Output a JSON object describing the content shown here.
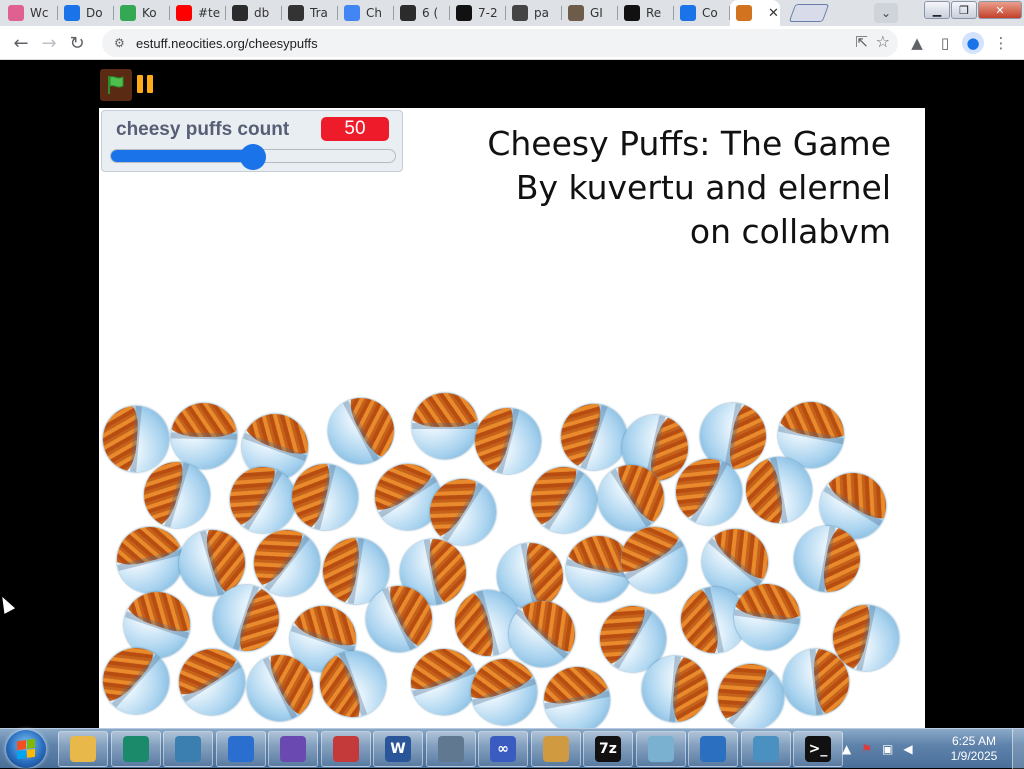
{
  "browser": {
    "tabs": [
      {
        "label": "Wc",
        "icon": "pinwheel-icon",
        "color": "#e0608f"
      },
      {
        "label": "Do",
        "icon": "download-icon",
        "color": "#1a73e8"
      },
      {
        "label": "Ko",
        "icon": "maps-pin-icon",
        "color": "#34a853"
      },
      {
        "label": "#te",
        "icon": "youtube-icon",
        "color": "#ff0000"
      },
      {
        "label": "db",
        "icon": "terminal-icon",
        "color": "#2b2b2b"
      },
      {
        "label": "Tra",
        "icon": "lightbulb-icon",
        "color": "#333333"
      },
      {
        "label": "Ch",
        "icon": "chrome-icon",
        "color": "#4285f4"
      },
      {
        "label": "6 (",
        "icon": "terminal-icon",
        "color": "#2b2b2b"
      },
      {
        "label": "7-2",
        "icon": "7zip-icon",
        "color": "#111111"
      },
      {
        "label": "pa",
        "icon": "trash-icon",
        "color": "#444444"
      },
      {
        "label": "GI",
        "icon": "gimp-icon",
        "color": "#6d5c4a"
      },
      {
        "label": "Re",
        "icon": "github-icon",
        "color": "#111111"
      },
      {
        "label": "Co",
        "icon": "search-icon",
        "color": "#1a73e8"
      },
      {
        "label": "",
        "icon": "cheesy-puffs-icon",
        "color": "#d2741f"
      }
    ],
    "active_tab_close": "✕",
    "url": "estuff.neocities.org/cheesypuffs"
  },
  "game": {
    "monitor": {
      "label": "cheesy puffs count",
      "value": "50",
      "slider_fraction": 0.5
    },
    "title_lines": [
      "Cheesy Puffs: The Game",
      "By kuvertu and elernel",
      "on collabvm"
    ],
    "bowl_count": 50
  },
  "taskbar": {
    "apps": [
      {
        "name": "explorer-icon",
        "color": "#e8b84a",
        "label": ""
      },
      {
        "name": "cycle-app-icon",
        "color": "#1a8a6a",
        "label": ""
      },
      {
        "name": "globe-icon",
        "color": "#3a7fb0",
        "label": ""
      },
      {
        "name": "usb-icon",
        "color": "#2a6fd0",
        "label": ""
      },
      {
        "name": "spiky-ball-icon",
        "color": "#6a4ab0",
        "label": ""
      },
      {
        "name": "paint-splat-icon",
        "color": "#c43a3a",
        "label": ""
      },
      {
        "name": "word-icon",
        "color": "#2a5699",
        "label": "W"
      },
      {
        "name": "security-shield-icon",
        "color": "#607890",
        "label": ""
      },
      {
        "name": "infinity-icon",
        "color": "#3a5cc0",
        "label": "∞"
      },
      {
        "name": "palette-icon",
        "color": "#d09a40",
        "label": ""
      },
      {
        "name": "7zip-app-icon",
        "color": "#111111",
        "label": "7z"
      },
      {
        "name": "notes-icon",
        "color": "#7ab0d0",
        "label": ""
      },
      {
        "name": "transfer-icon",
        "color": "#2a6fc0",
        "label": ""
      },
      {
        "name": "network-icon",
        "color": "#4a90c0",
        "label": ""
      },
      {
        "name": "cmd-icon",
        "color": "#111111",
        "label": ">_"
      }
    ],
    "time": "6:25 AM",
    "date": "1/9/2025"
  }
}
